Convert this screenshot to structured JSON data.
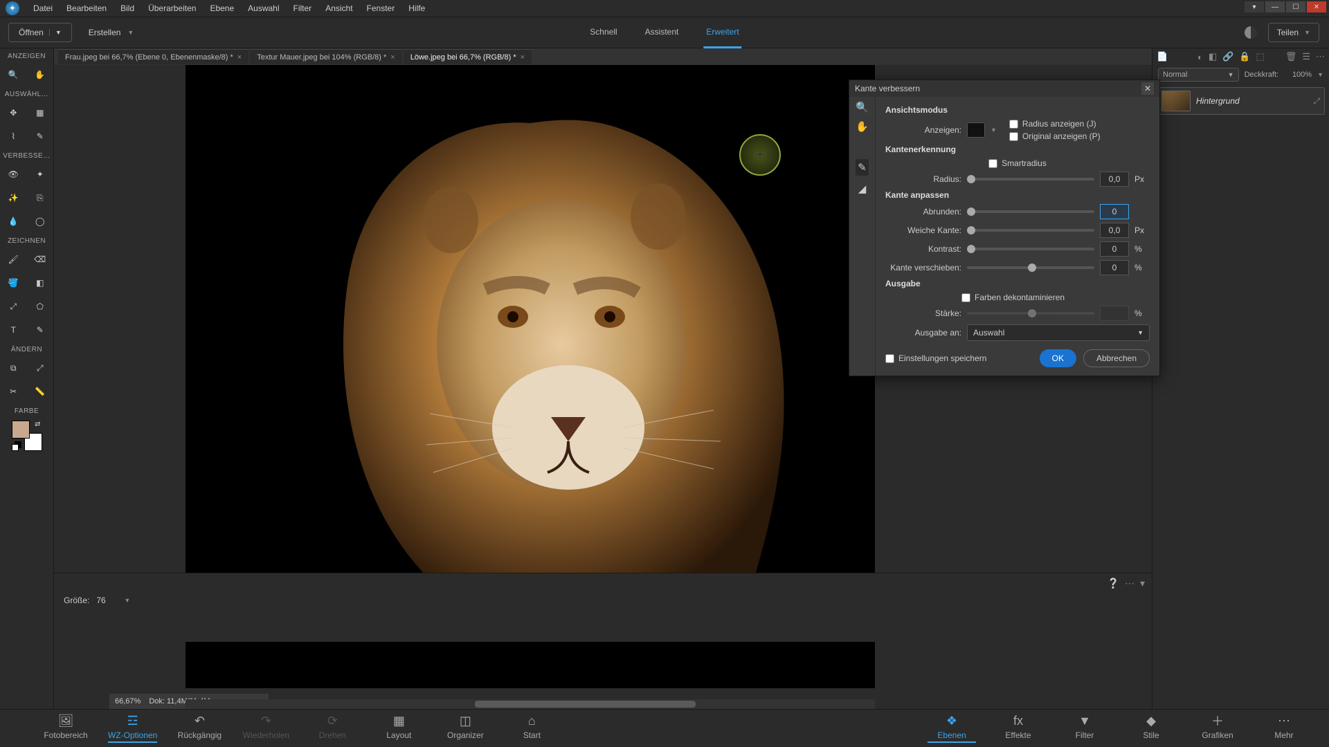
{
  "menu": {
    "items": [
      "Datei",
      "Bearbeiten",
      "Bild",
      "Überarbeiten",
      "Ebene",
      "Auswahl",
      "Filter",
      "Ansicht",
      "Fenster",
      "Hilfe"
    ]
  },
  "toolbar": {
    "open": "Öffnen",
    "create": "Erstellen",
    "modes": {
      "quick": "Schnell",
      "assistant": "Assistent",
      "advanced": "Erweitert"
    },
    "share": "Teilen"
  },
  "left_sections": {
    "view": "ANZEIGEN",
    "select": "AUSWÄHL…",
    "improve": "VERBESSE…",
    "draw": "ZEICHNEN",
    "modify": "ÄNDERN",
    "color": "FARBE"
  },
  "doc_tabs": [
    {
      "label": "Frau.jpeg bei 66,7% (Ebene 0, Ebenenmaske/8) *"
    },
    {
      "label": "Textur Mauer.jpeg bei 104% (RGB/8) *"
    },
    {
      "label": "Löwe.jpeg bei 66,7% (RGB/8) *"
    }
  ],
  "status": {
    "zoom": "66,67%",
    "doc": "Dok: 11,4M/11,4M"
  },
  "right": {
    "blend_mode": "Normal",
    "opacity_label": "Deckkraft:",
    "opacity": "100%",
    "layer_name": "Hintergrund"
  },
  "dialog": {
    "title": "Kante verbessern",
    "view_section": "Ansichtsmodus",
    "view_label": "Anzeigen:",
    "radius_show": "Radius anzeigen (J)",
    "original_show": "Original anzeigen (P)",
    "edge_section": "Kantenerkennung",
    "smart_radius": "Smartradius",
    "radius_label": "Radius:",
    "radius_val": "0,0",
    "px": "Px",
    "adjust_section": "Kante anpassen",
    "smooth_label": "Abrunden:",
    "smooth_val": "0",
    "feather_label": "Weiche Kante:",
    "feather_val": "0,0",
    "contrast_label": "Kontrast:",
    "contrast_val": "0",
    "pct": "%",
    "shift_label": "Kante verschieben:",
    "shift_val": "0",
    "output_section": "Ausgabe",
    "decontaminate": "Farben dekontaminieren",
    "strength_label": "Stärke:",
    "output_to_label": "Ausgabe an:",
    "output_to": "Auswahl",
    "save_settings": "Einstellungen speichern",
    "ok": "OK",
    "cancel": "Abbrechen"
  },
  "tooloptions": {
    "size_label": "Größe:",
    "size_val": "76"
  },
  "bottom_left": {
    "photo": "Fotobereich",
    "tool": "WZ-Optionen",
    "undo": "Rückgängig",
    "redo": "Wiederholen",
    "rotate": "Drehen",
    "layout": "Layout",
    "organizer": "Organizer",
    "start": "Start"
  },
  "bottom_right": {
    "layers": "Ebenen",
    "effects": "Effekte",
    "filter": "Filter",
    "styles": "Stile",
    "graphics": "Grafiken",
    "more": "Mehr"
  },
  "colors": {
    "accent": "#3aa5f0",
    "fg_swatch": "#c9a98e"
  }
}
